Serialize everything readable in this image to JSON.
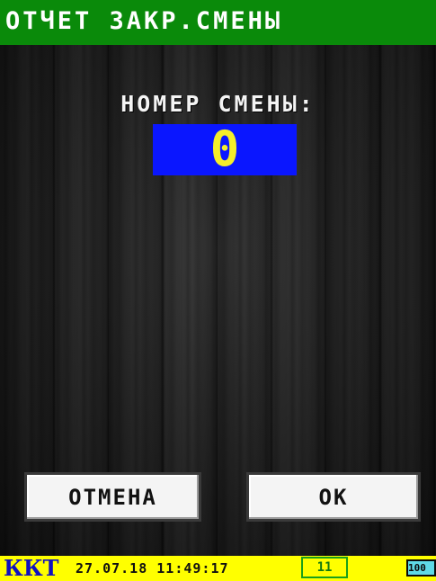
{
  "title": "ОТЧЕТ ЗАКР.СМЕНЫ",
  "shift": {
    "label": "НОМЕР СМЕНЫ:",
    "value": "0"
  },
  "buttons": {
    "cancel_label": "ОТМЕНА",
    "ok_label": "OK"
  },
  "status_bar": {
    "device": "ККТ",
    "datetime": "27.07.18 11:49:17",
    "counter": "11",
    "battery": "100"
  },
  "colors": {
    "title_bg": "#0a8a0a",
    "value_bg": "#0a16ff",
    "value_fg": "#f5ee2a",
    "status_bg": "#ffff00"
  }
}
